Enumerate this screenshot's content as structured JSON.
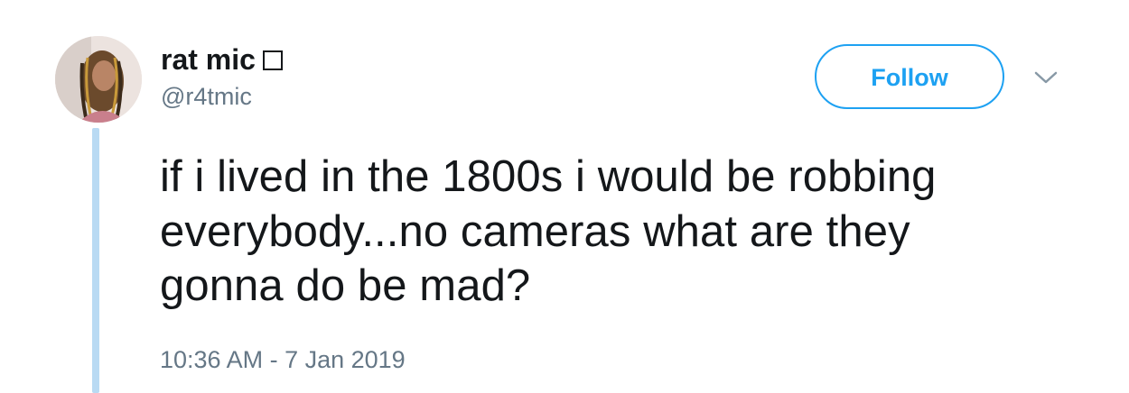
{
  "tweet": {
    "author": {
      "display_name": "rat mic",
      "handle": "@r4tmic",
      "avatar_icon": "profile-photo"
    },
    "follow_label": "Follow",
    "text_lines": [
      "if i lived in the 1800s i would be robbing",
      "everybody...no cameras what are they",
      "gonna do be mad?"
    ],
    "timestamp": "10:36 AM - 7 Jan 2019"
  },
  "colors": {
    "accent": "#1da1f2",
    "text": "#14171a",
    "secondary_text": "#657786",
    "thread_line": "#b9daf3"
  }
}
